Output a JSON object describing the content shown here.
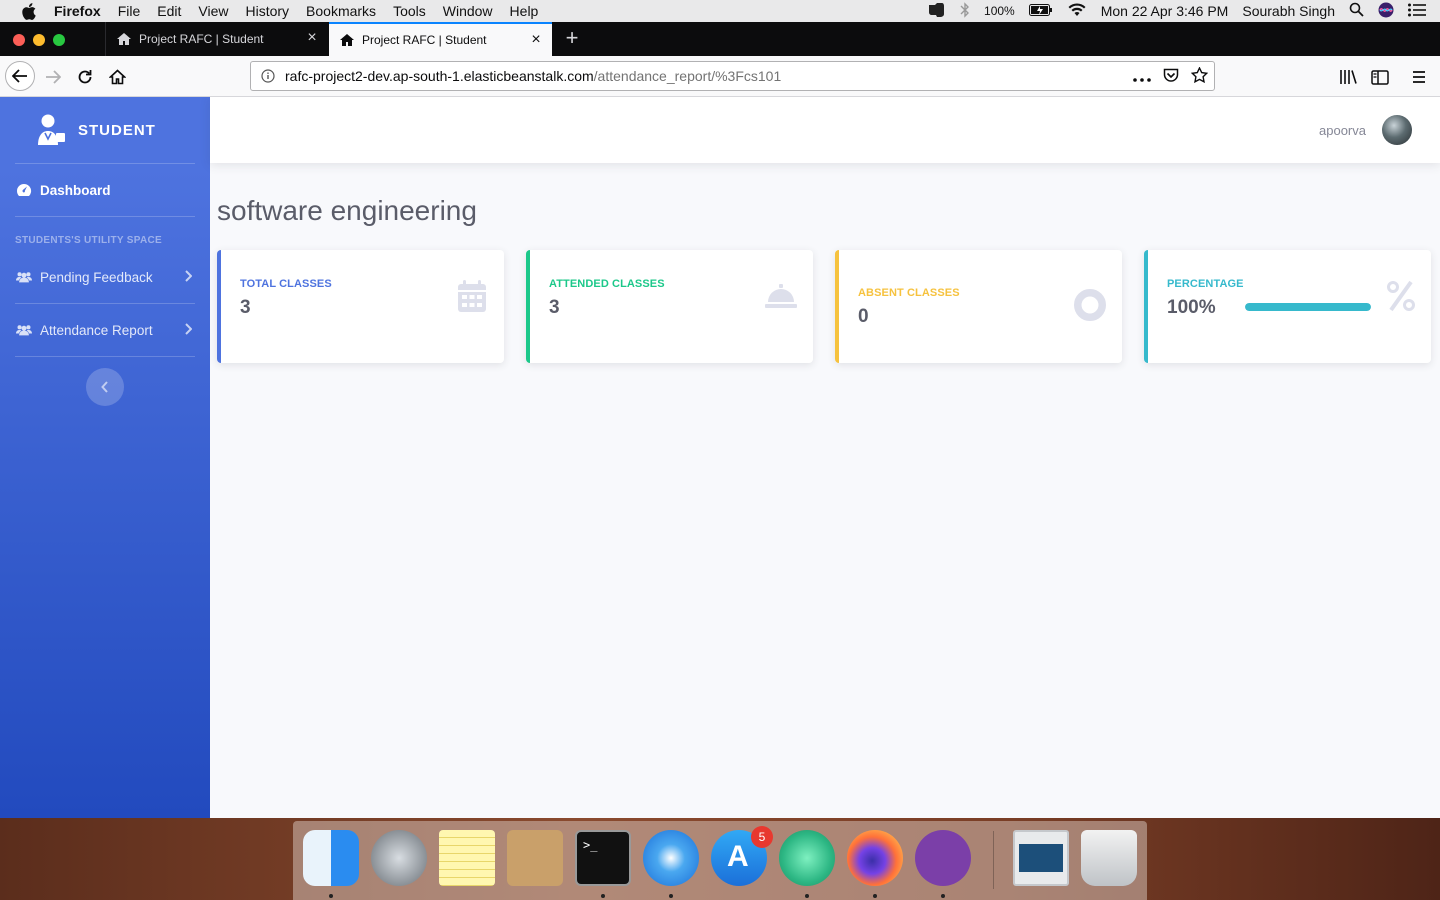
{
  "menubar": {
    "app_name": "Firefox",
    "menus": [
      "File",
      "Edit",
      "View",
      "History",
      "Bookmarks",
      "Tools",
      "Window",
      "Help"
    ],
    "battery": "100%",
    "datetime": "Mon 22 Apr  3:46 PM",
    "user": "Sourabh Singh"
  },
  "browser": {
    "tabs": [
      {
        "title": "Project RAFC | Student",
        "active": false
      },
      {
        "title": "Project RAFC | Student",
        "active": true
      }
    ],
    "url_host": "rafc-project2-dev.ap-south-1.elasticbeanstalk.com",
    "url_path": "/attendance_report/%3Fcs101"
  },
  "sidebar": {
    "brand": "STUDENT",
    "dashboard_label": "Dashboard",
    "heading": "STUDENTS'S UTILITY SPACE",
    "items": [
      {
        "label": "Pending Feedback"
      },
      {
        "label": "Attendance Report"
      }
    ]
  },
  "topbar": {
    "user_name": "apoorva"
  },
  "main": {
    "title": "software engineering",
    "cards": [
      {
        "label": "TOTAL CLASSES",
        "value": "3",
        "color": "#4e73df",
        "icon": "calendar-icon"
      },
      {
        "label": "ATTENDED CLASSES",
        "value": "3",
        "color": "#1cc88a",
        "icon": "bell-icon"
      },
      {
        "label": "ABSENT CLASSES",
        "value": "0",
        "color": "#f6c23e",
        "icon": "circle-icon"
      },
      {
        "label": "PERCENTAGE",
        "value": "100%",
        "color": "#36b9cc",
        "icon": "percent-icon",
        "progress": 1.0
      }
    ]
  },
  "dock": {
    "apps": [
      "finder",
      "launchpad",
      "notes",
      "archive-utility",
      "terminal",
      "safari",
      "app-store",
      "atom",
      "firefox",
      "github-desktop",
      "preview-window",
      "trash"
    ],
    "app_store_badge": "5"
  }
}
